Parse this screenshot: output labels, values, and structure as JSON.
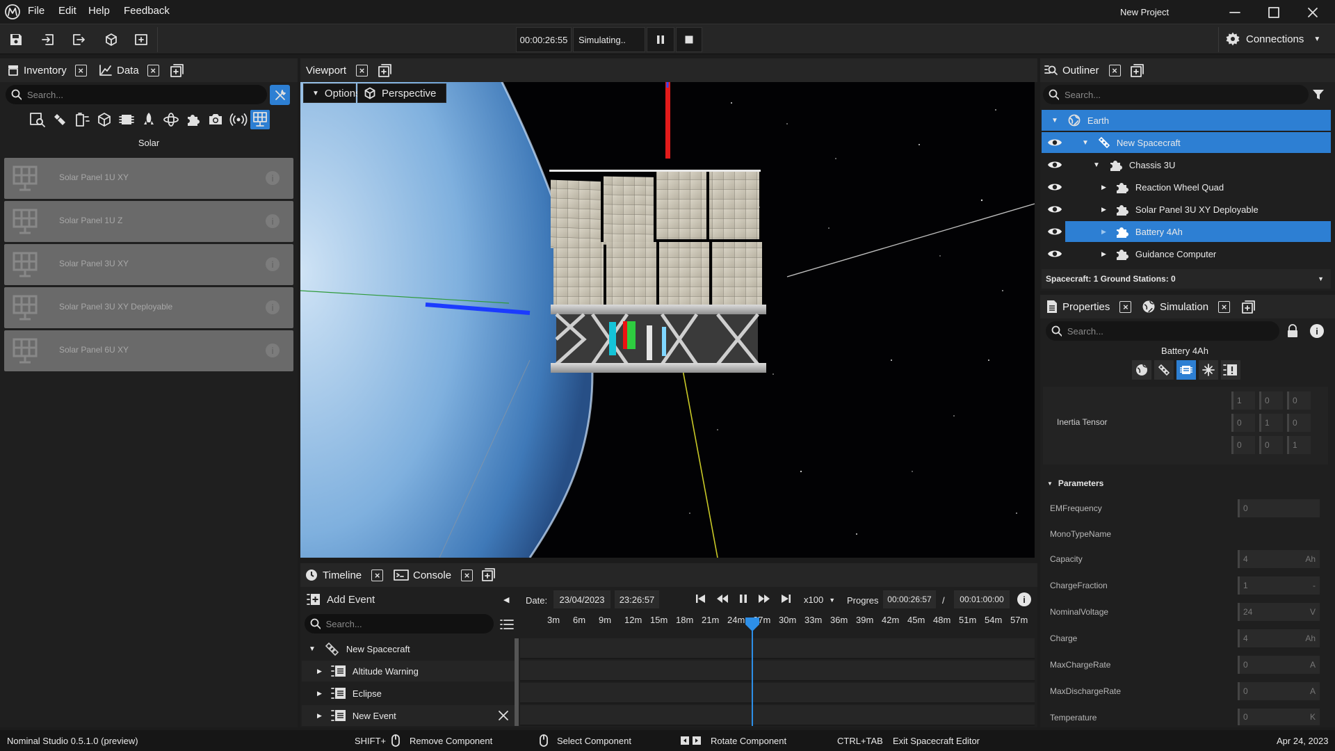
{
  "app": {
    "title": "New Project"
  },
  "menu": {
    "file": "File",
    "edit": "Edit",
    "help": "Help",
    "feedback": "Feedback"
  },
  "toolbar": {
    "sim_time": "00:00:26:55",
    "sim_status": "Simulating..",
    "connections": "Connections"
  },
  "left": {
    "tabs": {
      "inventory": "Inventory",
      "data": "Data"
    },
    "search_placeholder": "Search...",
    "category_label": "Solar",
    "items": [
      "Solar Panel 1U XY",
      "Solar Panel 1U Z",
      "Solar Panel 3U XY",
      "Solar Panel 3U XY Deployable",
      "Solar Panel 6U XY"
    ]
  },
  "viewport": {
    "tab": "Viewport",
    "options": "Options",
    "perspective": "Perspective"
  },
  "outliner": {
    "tab": "Outliner",
    "search_placeholder": "Search...",
    "rows": [
      "Earth",
      "New Spacecraft",
      "Chassis 3U",
      "Reaction Wheel Quad",
      "Solar Panel 3U XY Deployable",
      "Battery 4Ah",
      "Guidance Computer"
    ],
    "summary": "Spacecraft: 1 Ground Stations: 0"
  },
  "properties": {
    "tabs": {
      "properties": "Properties",
      "simulation": "Simulation"
    },
    "search_placeholder": "Search...",
    "selected": "Battery 4Ah",
    "inertia_label": "Inertia Tensor",
    "inertia": [
      "1",
      "0",
      "0",
      "0",
      "1",
      "0",
      "0",
      "0",
      "1"
    ],
    "parameters_label": "Parameters",
    "params": [
      {
        "name": "EMFrequency",
        "value": "0",
        "unit": ""
      },
      {
        "name": "MonoTypeName",
        "value": "",
        "unit": ""
      },
      {
        "name": "Capacity",
        "value": "4",
        "unit": "Ah"
      },
      {
        "name": "ChargeFraction",
        "value": "1",
        "unit": "-"
      },
      {
        "name": "NominalVoltage",
        "value": "24",
        "unit": "V"
      },
      {
        "name": "Charge",
        "value": "4",
        "unit": "Ah"
      },
      {
        "name": "MaxChargeRate",
        "value": "0",
        "unit": "A"
      },
      {
        "name": "MaxDischargeRate",
        "value": "0",
        "unit": "A"
      },
      {
        "name": "Temperature",
        "value": "0",
        "unit": "K"
      }
    ]
  },
  "timeline": {
    "tabs": {
      "timeline": "Timeline",
      "console": "Console"
    },
    "add_event": "Add Event",
    "date_label": "Date:",
    "date": "23/04/2023",
    "time": "23:26:57",
    "speed": "x100",
    "progress_label": "Progres",
    "progress": "00:00:26:57",
    "slash": "/",
    "duration": "00:01:00:00",
    "search_placeholder": "Search...",
    "ticks": [
      "3m",
      "6m",
      "9m",
      "12m",
      "15m",
      "18m",
      "21m",
      "24m",
      "27m",
      "30m",
      "33m",
      "36m",
      "39m",
      "42m",
      "45m",
      "48m",
      "51m",
      "54m",
      "57m"
    ],
    "tree": {
      "root": "New Spacecraft",
      "events": [
        "Altitude Warning",
        "Eclipse",
        "New Event"
      ]
    }
  },
  "status": {
    "version": "Nominal Studio 0.5.1.0 (preview)",
    "shift": "SHIFT+",
    "remove": "Remove Component",
    "select": "Select Component",
    "rotate": "Rotate Component",
    "ctrltab": "CTRL+TAB",
    "exit": "Exit Spacecraft Editor",
    "date": "Apr 24, 2023"
  }
}
